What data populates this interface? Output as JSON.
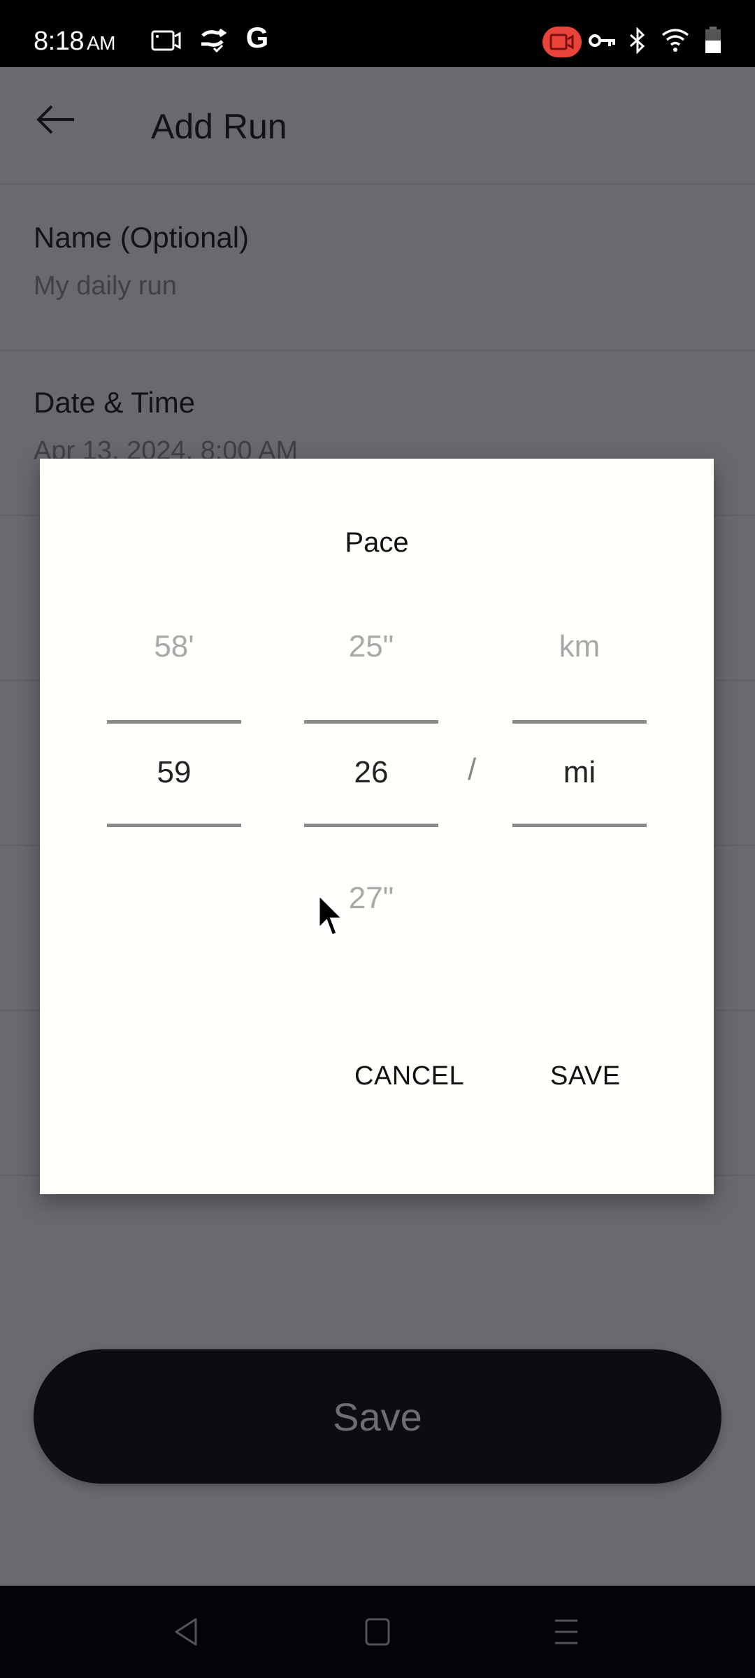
{
  "status_bar": {
    "time": "8:18",
    "ampm": "AM",
    "left_icons": [
      "screen-record-icon",
      "sync-check-icon",
      "google-icon"
    ],
    "google_glyph": "G",
    "right_icons": [
      "recording-indicator-icon",
      "vpn-key-icon",
      "bluetooth-icon",
      "wifi-icon",
      "battery-icon"
    ],
    "recording_color": "#e8443a"
  },
  "app_bar": {
    "back_icon": "arrow-left-icon",
    "title": "Add Run"
  },
  "form": {
    "fields": [
      {
        "label": "Name (Optional)",
        "value": "My daily run"
      },
      {
        "label": "Date & Time",
        "value": "Apr 13, 2024, 8:00 AM"
      }
    ],
    "save_button": "Save"
  },
  "dialog": {
    "title": "Pace",
    "minutes": {
      "prev": "58'",
      "selected": "59",
      "next": ""
    },
    "seconds": {
      "prev": "25\"",
      "selected": "26",
      "next": "27\""
    },
    "unit": {
      "prev": "km",
      "selected": "mi",
      "next": ""
    },
    "separator": "/",
    "cancel_label": "CANCEL",
    "save_label": "SAVE"
  },
  "nav_bar": {
    "icons": [
      "nav-back-icon",
      "nav-home-icon",
      "nav-menu-icon"
    ]
  }
}
